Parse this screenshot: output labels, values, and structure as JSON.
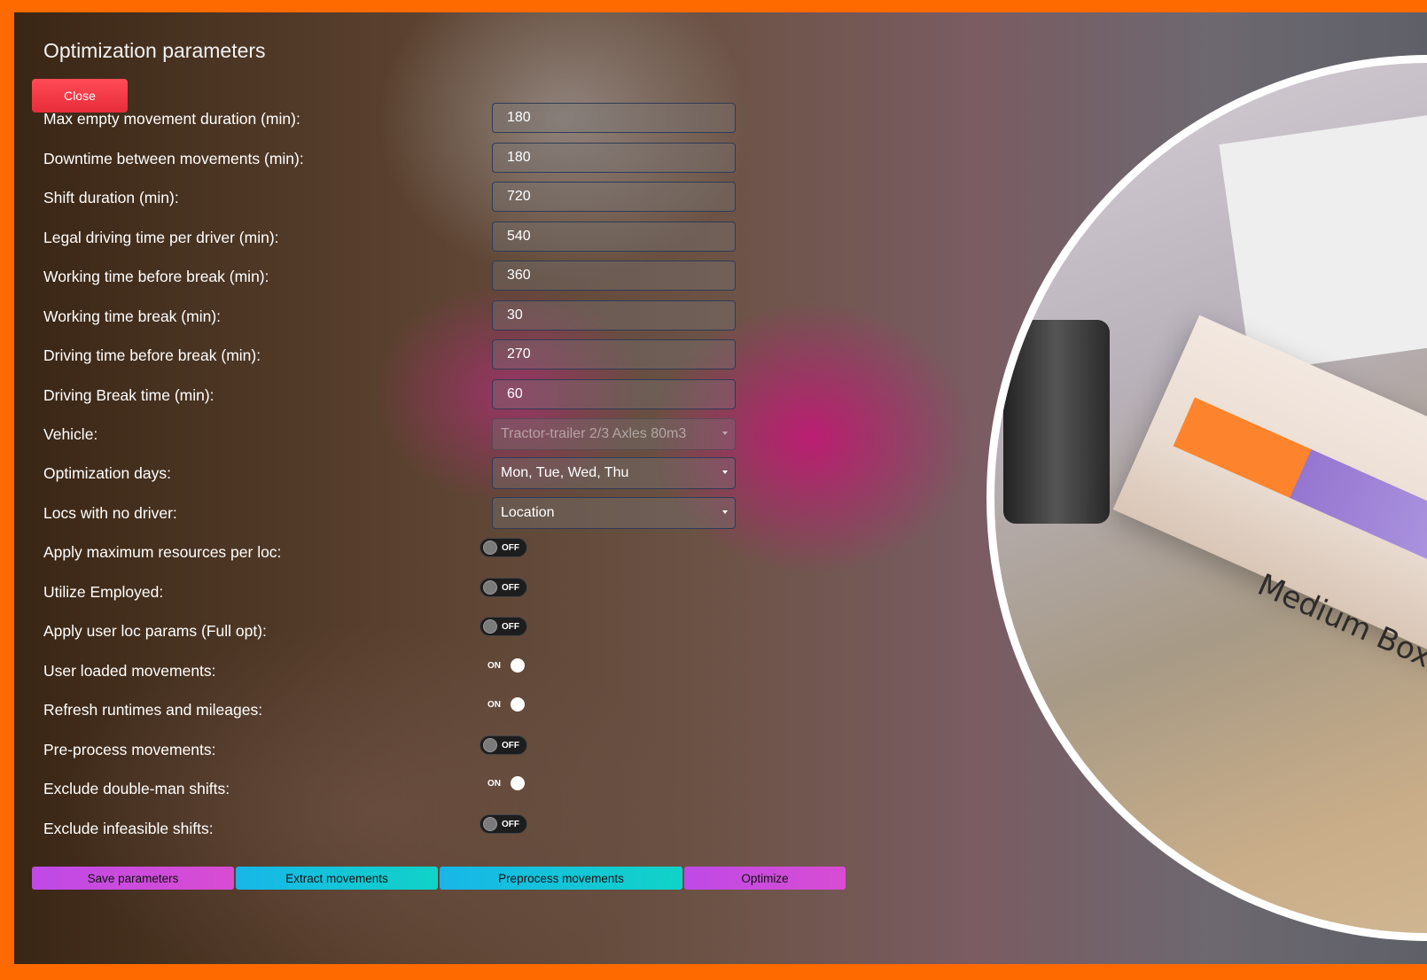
{
  "dialog": {
    "title": "Optimization parameters",
    "close_label": "Close"
  },
  "fields": [
    {
      "label": "Max empty movement duration (min):",
      "value": "180"
    },
    {
      "label": "Downtime between movements (min):",
      "value": "180"
    },
    {
      "label": "Shift duration (min):",
      "value": "720"
    },
    {
      "label": "Legal driving time per driver (min):",
      "value": "540"
    },
    {
      "label": "Working time before break (min):",
      "value": "360"
    },
    {
      "label": "Working time break (min):",
      "value": "30"
    },
    {
      "label": "Driving time before break (min):",
      "value": "270"
    },
    {
      "label": "Driving Break time (min):",
      "value": "60"
    }
  ],
  "selects": [
    {
      "label": "Vehicle:",
      "value": "Tractor-trailer 2/3 Axles 80m3",
      "disabled": true
    },
    {
      "label": "Optimization days:",
      "value": "Mon, Tue, Wed, Thu",
      "disabled": false
    },
    {
      "label": "Locs with no driver:",
      "value": "Location",
      "disabled": false
    }
  ],
  "toggles": [
    {
      "label": "Apply maximum resources per loc:",
      "state": "OFF"
    },
    {
      "label": "Utilize Employed:",
      "state": "OFF"
    },
    {
      "label": "Apply user loc params (Full opt):",
      "state": "OFF"
    },
    {
      "label": "User loaded movements:",
      "state": "ON"
    },
    {
      "label": "Refresh runtimes and mileages:",
      "state": "ON"
    },
    {
      "label": "Pre-process movements:",
      "state": "OFF"
    },
    {
      "label": "Exclude double-man shifts:",
      "state": "ON"
    },
    {
      "label": "Exclude infeasible shifts:",
      "state": "OFF"
    }
  ],
  "actions": {
    "save": "Save parameters",
    "extract": "Extract movements",
    "preprocess": "Preprocess movements",
    "optimize": "Optimize"
  },
  "background_photo": {
    "box_text": "Medium Box"
  },
  "colors": {
    "border": "#ff6a00",
    "close": "#ff4b55",
    "purple_button": "#c94be0",
    "teal_button": "#14c4d8"
  }
}
